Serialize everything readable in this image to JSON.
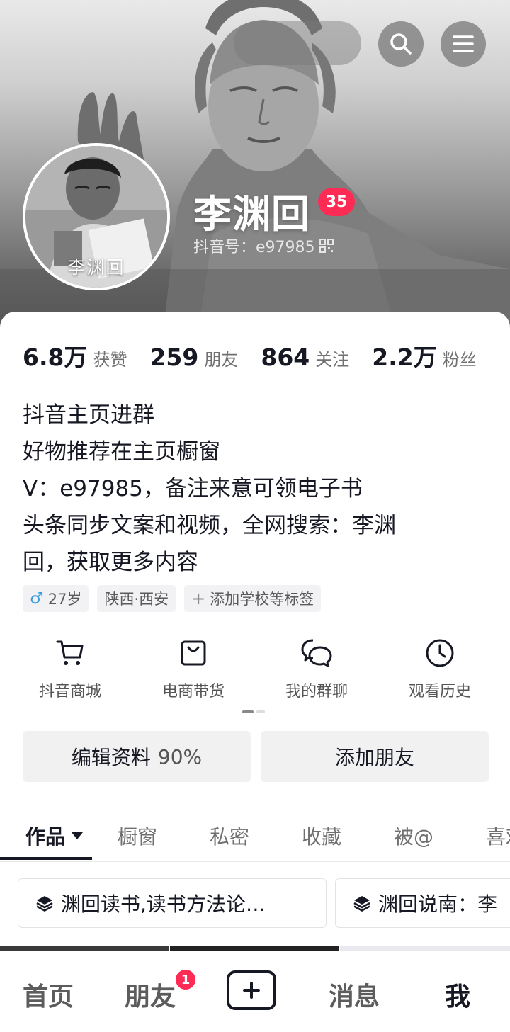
{
  "profile": {
    "name": "李渊回",
    "level": "35",
    "douyin_id": "抖音号：e97985",
    "avatar_text": "李渊回"
  },
  "stats": [
    {
      "value": "6.8万",
      "label": "获赞"
    },
    {
      "value": "259",
      "label": "朋友"
    },
    {
      "value": "864",
      "label": "关注"
    },
    {
      "value": "2.2万",
      "label": "粉丝"
    }
  ],
  "bio": [
    "抖音主页进群",
    "好物推荐在主页橱窗",
    "V：e97985，备注来意可领电子书",
    "头条同步文案和视频，全网搜索：李渊",
    "回，获取更多内容"
  ],
  "tags": {
    "gender_symbol": "♂",
    "age": "27岁",
    "location": "陕西·西安",
    "add_symbol": "+",
    "add_school": "添加学校等标签"
  },
  "shortcuts": [
    {
      "label": "抖音商城",
      "icon": "cart-icon"
    },
    {
      "label": "电商带货",
      "icon": "shopping-bag-icon"
    },
    {
      "label": "我的群聊",
      "icon": "chat-bubbles-icon"
    },
    {
      "label": "观看历史",
      "icon": "clock-icon"
    }
  ],
  "actions": {
    "edit_profile": "编辑资料",
    "edit_progress": "90%",
    "add_friend": "添加朋友"
  },
  "tabs": [
    "作品",
    "橱窗",
    "私密",
    "收藏",
    "被@",
    "喜欢"
  ],
  "collections": [
    "渊回读书,读书方法论…",
    "渊回说南：李"
  ],
  "bottom_nav": {
    "home": "首页",
    "friends": "朋友",
    "friends_badge": "1",
    "messages": "消息",
    "me": "我"
  },
  "colors": {
    "accent": "#fe2c55",
    "text_primary": "#161823",
    "text_secondary": "#707070"
  }
}
